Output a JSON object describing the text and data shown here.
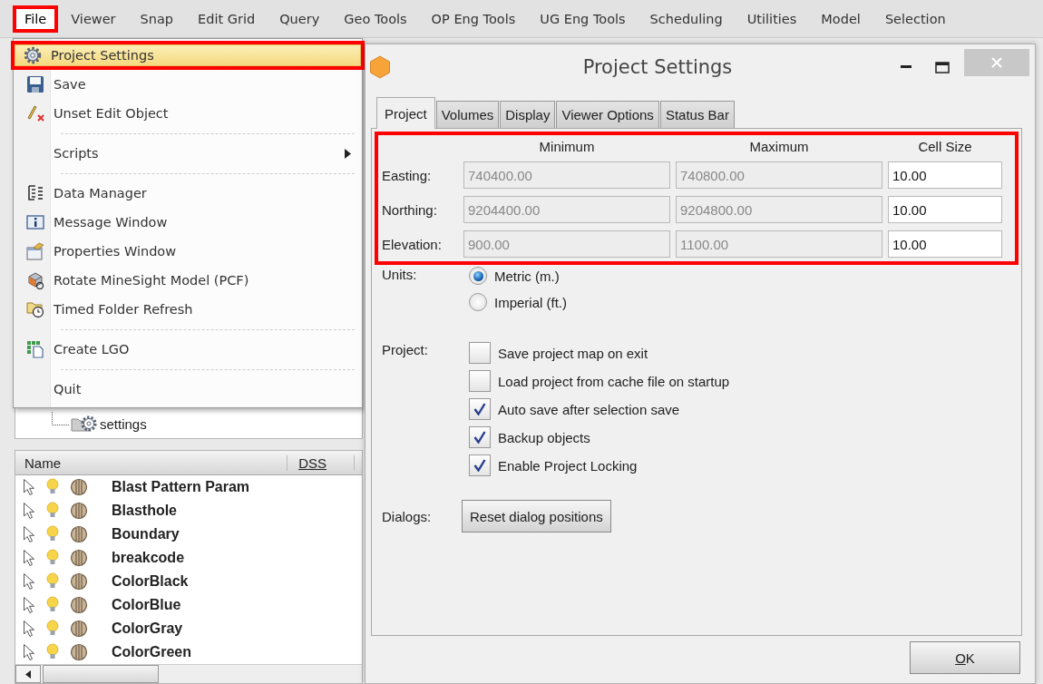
{
  "menubar": {
    "items": [
      {
        "label": "File",
        "selected": true,
        "highlighted": true
      },
      {
        "label": "Viewer",
        "selected": false,
        "highlighted": false
      },
      {
        "label": "Snap",
        "selected": false,
        "highlighted": false
      },
      {
        "label": "Edit Grid",
        "selected": false,
        "highlighted": false
      },
      {
        "label": "Query",
        "selected": false,
        "highlighted": false
      },
      {
        "label": "Geo Tools",
        "selected": false,
        "highlighted": false
      },
      {
        "label": "OP Eng Tools",
        "selected": false,
        "highlighted": false
      },
      {
        "label": "UG Eng Tools",
        "selected": false,
        "highlighted": false
      },
      {
        "label": "Scheduling",
        "selected": false,
        "highlighted": false
      },
      {
        "label": "Utilities",
        "selected": false,
        "highlighted": false
      },
      {
        "label": "Model",
        "selected": false,
        "highlighted": false
      },
      {
        "label": "Selection",
        "selected": false,
        "highlighted": false
      }
    ]
  },
  "file_menu": {
    "items": [
      {
        "kind": "item",
        "label": "Project Settings",
        "selected": true,
        "highlighted": true
      },
      {
        "kind": "item",
        "label": "Save",
        "selected": false,
        "highlighted": false
      },
      {
        "kind": "item",
        "label": "Unset Edit Object",
        "selected": false,
        "highlighted": false
      },
      {
        "kind": "separator"
      },
      {
        "kind": "submenu",
        "label": "Scripts",
        "selected": false,
        "highlighted": false
      },
      {
        "kind": "separator"
      },
      {
        "kind": "item",
        "label": "Data Manager",
        "selected": false,
        "highlighted": false
      },
      {
        "kind": "item",
        "label": "Message Window",
        "selected": false,
        "highlighted": false
      },
      {
        "kind": "item",
        "label": "Properties Window",
        "selected": false,
        "highlighted": false
      },
      {
        "kind": "item",
        "label": "Rotate MineSight Model (PCF)",
        "selected": false,
        "highlighted": false
      },
      {
        "kind": "item",
        "label": "Timed Folder Refresh",
        "selected": false,
        "highlighted": false
      },
      {
        "kind": "separator"
      },
      {
        "kind": "item",
        "label": "Create LGO",
        "selected": false,
        "highlighted": false
      },
      {
        "kind": "separator"
      },
      {
        "kind": "item",
        "label": "Quit",
        "selected": false,
        "highlighted": false
      }
    ]
  },
  "tree": {
    "items": [
      {
        "label": "settings"
      }
    ]
  },
  "object_list": {
    "columns": [
      "Name",
      "DSS"
    ],
    "rows": [
      {
        "name": "Blast Pattern Param"
      },
      {
        "name": "Blasthole"
      },
      {
        "name": "Boundary"
      },
      {
        "name": "breakcode"
      },
      {
        "name": "ColorBlack"
      },
      {
        "name": "ColorBlue"
      },
      {
        "name": "ColorGray"
      },
      {
        "name": "ColorGreen"
      }
    ]
  },
  "dialog": {
    "title": "Project Settings",
    "tabs": [
      {
        "label": "Project",
        "selected": true
      },
      {
        "label": "Volumes",
        "selected": false
      },
      {
        "label": "Display",
        "selected": false
      },
      {
        "label": "Viewer Options",
        "selected": false
      },
      {
        "label": "Status Bar",
        "selected": false
      }
    ],
    "extents": {
      "highlighted": true,
      "columns": [
        "Minimum",
        "Maximum",
        "Cell Size"
      ],
      "rows": [
        {
          "label": "Easting:",
          "minimum": "740400.00",
          "maximum": "740800.00",
          "cell_size": "10.00",
          "range_disabled": true
        },
        {
          "label": "Northing:",
          "minimum": "9204400.00",
          "maximum": "9204800.00",
          "cell_size": "10.00",
          "range_disabled": true
        },
        {
          "label": "Elevation:",
          "minimum": "900.00",
          "maximum": "1100.00",
          "cell_size": "10.00",
          "range_disabled": true
        }
      ]
    },
    "units": {
      "label": "Units:",
      "options": [
        {
          "label": "Metric (m.)",
          "selected": true
        },
        {
          "label": "Imperial (ft.)",
          "selected": false
        }
      ]
    },
    "project": {
      "label": "Project:",
      "options": [
        {
          "label": "Save project map on exit",
          "checked": false
        },
        {
          "label": "Load project from cache file on startup",
          "checked": false
        },
        {
          "label": "Auto save after selection save",
          "checked": true
        },
        {
          "label": "Backup objects",
          "checked": true
        },
        {
          "label": "Enable Project Locking",
          "checked": true
        }
      ]
    },
    "dialogs": {
      "label": "Dialogs:",
      "button": "Reset dialog positions"
    },
    "ok_button": "OK"
  }
}
